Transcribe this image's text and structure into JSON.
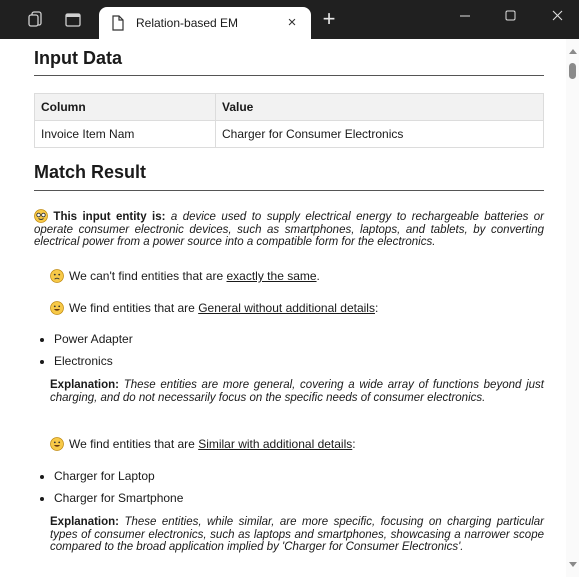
{
  "browser": {
    "tab_title": "Relation-based EM",
    "tab_close": "×",
    "new_tab": "+",
    "minimize": "–",
    "maximize": "▢",
    "close": "✕"
  },
  "input_section": {
    "heading": "Input Data",
    "columns": [
      "Column",
      "Value"
    ],
    "rows": [
      [
        "Invoice Item Nam",
        "Charger for Consumer Electronics"
      ]
    ]
  },
  "match_section": {
    "heading": "Match Result",
    "entity_label": "This input entity is:",
    "entity_description": "a device used to supply electrical energy to rechargeable batteries or operate consumer electronic devices, such as smartphones, laptops, and tablets, by converting electrical power from a power source into a compatible form for the electronics.",
    "exact": {
      "prefix": "We can't find entities that are ",
      "link": "exactly the same",
      "suffix": "."
    },
    "general": {
      "prefix": "We find entities that are ",
      "link": "General without additional details",
      "suffix": ":",
      "items": [
        "Power Adapter",
        "Electronics"
      ],
      "explanation_label": "Explanation:",
      "explanation": "These entities are more general, covering a wide array of functions beyond just charging, and do not necessarily focus on the specific needs of consumer electronics."
    },
    "similar": {
      "prefix": "We find entities that are ",
      "link": "Similar with additional details",
      "suffix": ":",
      "items": [
        "Charger for Laptop",
        "Charger for Smartphone"
      ],
      "explanation_label": "Explanation:",
      "explanation": "These entities, while similar, are more specific, focusing on charging particular types of consumer electronics, such as laptops and smartphones, showcasing a narrower scope compared to the broad application implied by 'Charger for Consumer Electronics'."
    }
  },
  "icons": {
    "entity_icon": "nerd-face-icon",
    "exact_icon": "sad-face-icon",
    "general_icon": "smiling-face-icon",
    "similar_icon": "smiling-face-icon"
  },
  "colors": {
    "titlebar": "#202020",
    "table_header": "#f2f2f2",
    "emoji_yellow": "#f7c948"
  }
}
